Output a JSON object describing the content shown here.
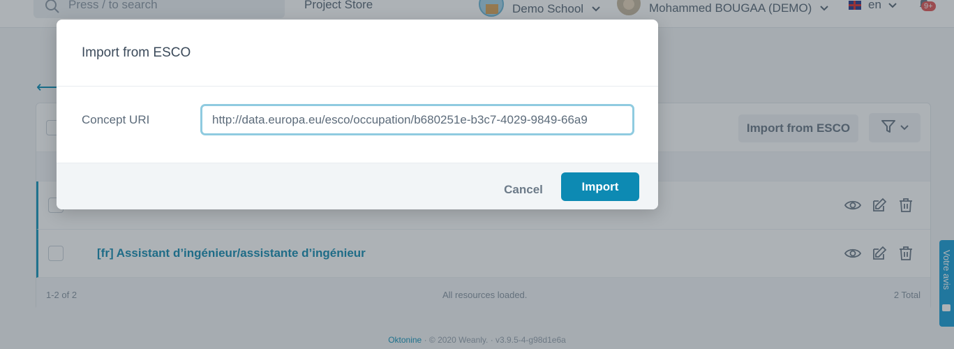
{
  "topbar": {
    "search_placeholder": "Press / to search",
    "project_store": "Project Store",
    "school": "Demo School",
    "user": "Mohammed BOUGAA (DEMO)",
    "language": "en",
    "notifications_badge": "9+"
  },
  "page": {
    "import_button": "Import from ESCO",
    "rows": [
      {
        "title": ""
      },
      {
        "title": "[fr] Assistant d’ingénieur/assistante d’ingénieur"
      }
    ],
    "footer_count": "1-2 of 2",
    "footer_status": "All resources loaded.",
    "footer_total": "2 Total"
  },
  "site_footer": {
    "brand": "Oktonine",
    "copyright": "© 2020 Weanly.",
    "version": "v3.9.5-4-g98d1e6a"
  },
  "feedback_tab": "Votre avis",
  "modal": {
    "title": "Import from ESCO",
    "field_label": "Concept URI",
    "field_value": "http://data.europa.eu/esco/occupation/b680251e-b3c7-4029-9849-66a9",
    "cancel": "Cancel",
    "import": "Import"
  },
  "colors": {
    "accent": "#0d8ab3",
    "input_focus_border": "#8fcbe0",
    "row_title": "#1a8fb3"
  }
}
